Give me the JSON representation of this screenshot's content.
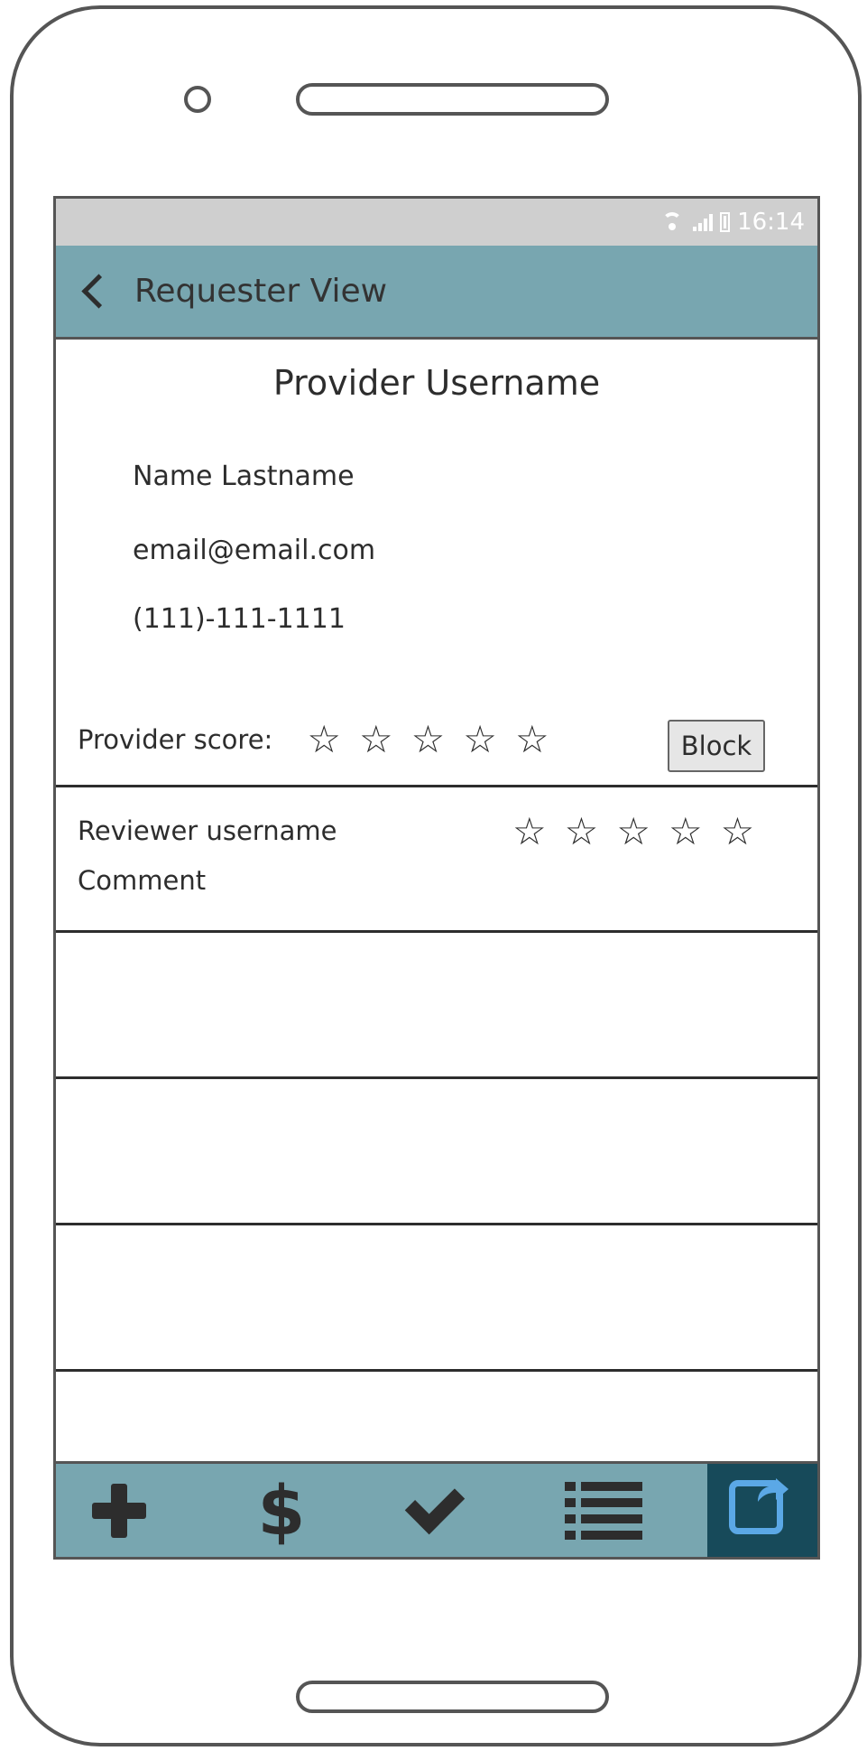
{
  "status_bar": {
    "time": "16:14"
  },
  "app_bar": {
    "title": "Requester View",
    "back_icon": "chevron-left-icon"
  },
  "provider": {
    "username": "Provider Username",
    "name": "Name Lastname",
    "email": "email@email.com",
    "phone": "(111)-111-1111",
    "score_label": "Provider score:",
    "score_stars_filled": 0,
    "score_stars_total": 5,
    "block_label": "Block"
  },
  "review": {
    "username": "Reviewer username",
    "comment": "Comment",
    "stars_filled": 0,
    "stars_total": 5
  },
  "bottom_nav": {
    "items": [
      {
        "icon": "plus-icon",
        "active": false
      },
      {
        "icon": "dollar-icon",
        "active": false
      },
      {
        "icon": "check-icon",
        "active": false
      },
      {
        "icon": "list-icon",
        "active": false
      },
      {
        "icon": "share-icon",
        "active": true
      }
    ],
    "active_color": "#174a5a",
    "bar_color": "#78a6b0"
  },
  "colors": {
    "app_bar": "#78a6b0",
    "status_bar": "#cfcfcf",
    "share_icon": "#5ba8e6"
  }
}
